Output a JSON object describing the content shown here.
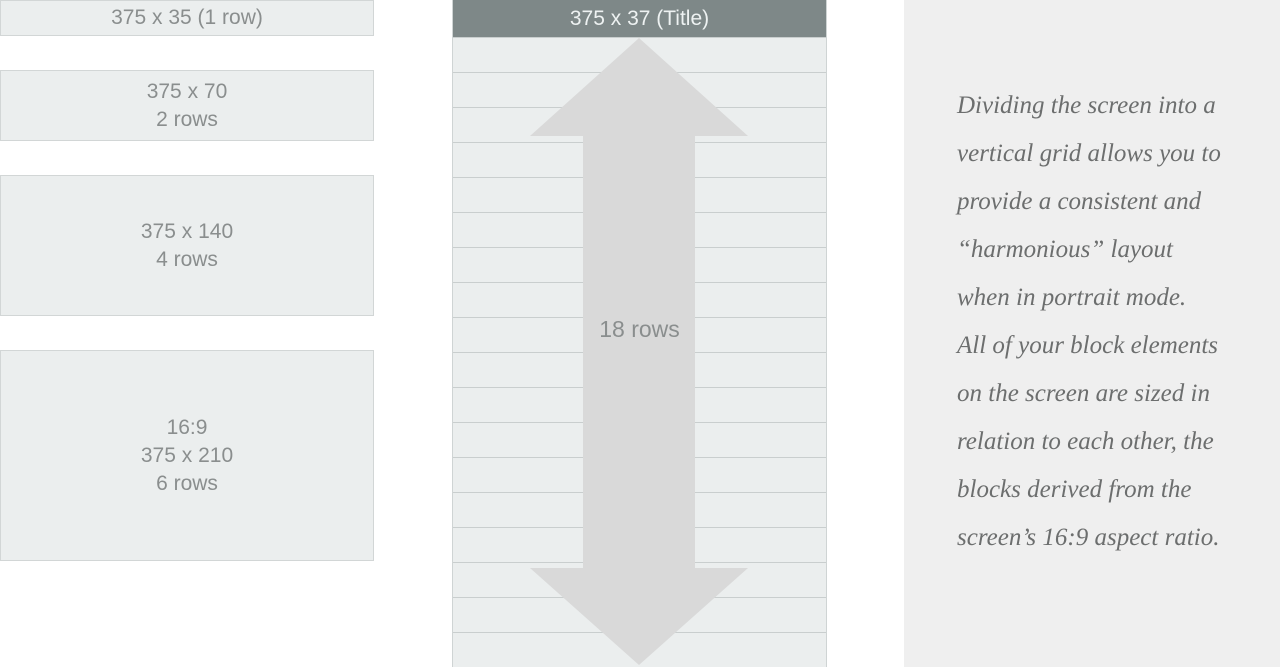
{
  "blocks": [
    {
      "lines": [
        "375 x 35 (1 row)"
      ]
    },
    {
      "lines": [
        "375 x 70",
        "2 rows"
      ]
    },
    {
      "lines": [
        "375 x 140",
        "4 rows"
      ]
    },
    {
      "lines": [
        "16:9",
        "375 x 210",
        "6 rows"
      ]
    }
  ],
  "phone": {
    "title": "375 x 37 (Title)",
    "arrow_label": "18 rows"
  },
  "description": {
    "lines": [
      "Dividing the screen into a",
      "vertical grid allows you to",
      "provide a consistent and",
      "“harmonious” layout",
      "when in portrait mode.",
      "All of your block elements",
      "on the screen are sized in",
      "relation to each other, the",
      "blocks derived from the",
      "screen’s 16:9 aspect ratio."
    ]
  },
  "colors": {
    "block_fill": "#ebeeee",
    "title_bar": "#7e8888",
    "arrow": "#d9d9d9",
    "panel": "#efefef"
  },
  "icons": [
    "double-headed-vertical-arrow-icon"
  ]
}
